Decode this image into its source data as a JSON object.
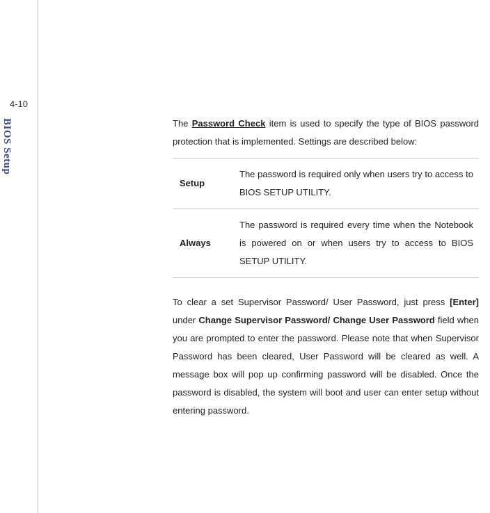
{
  "page": {
    "number": "4-10",
    "spine_label": "BIOS Setup"
  },
  "intro": {
    "prefix": "The ",
    "key_phrase": "Password Check",
    "rest": " item is used to specify the type of BIOS password protection that is implemented.   Settings are described below:"
  },
  "settings": [
    {
      "label": "Setup",
      "desc": "The password is required only when users try to access to BIOS SETUP UTILITY."
    },
    {
      "label": "Always",
      "desc": "The password is required every time when the Notebook is powered on or when users try to access to BIOS SETUP UTILITY."
    }
  ],
  "clear": {
    "p1": "To clear a set Supervisor Password/ User Password, just press ",
    "enter": "[Enter]",
    "p2": " under ",
    "change": "Change Supervisor Password/ Change User Password",
    "p3": " field when you are prompted to enter the password.  Please note that when Supervisor Password has been cleared, User Password will be cleared as well. A message box will pop up confirming password will be disabled. Once the password is disabled, the system will boot and user can enter setup without entering password."
  }
}
